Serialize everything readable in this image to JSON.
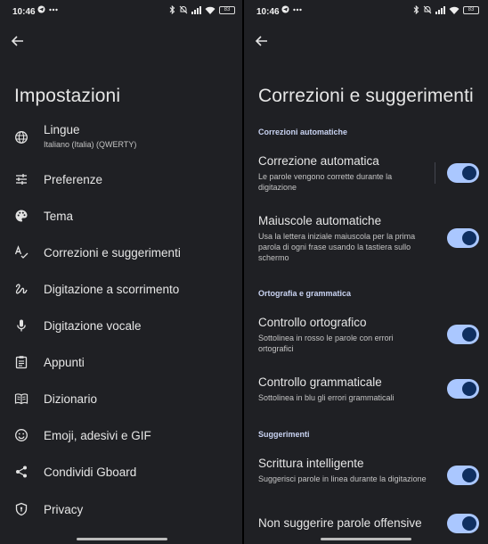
{
  "status": {
    "time": "10:46",
    "battery": "83"
  },
  "left": {
    "title": "Impostazioni",
    "items": [
      {
        "label": "Lingue",
        "sub": "Italiano (Italia) (QWERTY)",
        "icon": "globe-icon"
      },
      {
        "label": "Preferenze",
        "icon": "sliders-icon"
      },
      {
        "label": "Tema",
        "icon": "palette-icon"
      },
      {
        "label": "Correzioni e suggerimenti",
        "icon": "spellcheck-icon"
      },
      {
        "label": "Digitazione a scorrimento",
        "icon": "gesture-icon"
      },
      {
        "label": "Digitazione vocale",
        "icon": "microphone-icon"
      },
      {
        "label": "Appunti",
        "icon": "clipboard-icon"
      },
      {
        "label": "Dizionario",
        "icon": "book-icon"
      },
      {
        "label": "Emoji, adesivi e GIF",
        "icon": "emoji-icon"
      },
      {
        "label": "Condividi Gboard",
        "icon": "share-icon"
      },
      {
        "label": "Privacy",
        "icon": "shield-icon"
      }
    ]
  },
  "right": {
    "title": "Correzioni e suggerimenti",
    "sections": [
      {
        "header": "Correzioni automatiche"
      },
      {
        "header": "Ortografia e grammatica"
      },
      {
        "header": "Suggerimenti"
      }
    ],
    "settings": [
      {
        "title": "Correzione automatica",
        "desc": "Le parole vengono corrette durante la digitazione",
        "on": true
      },
      {
        "title": "Maiuscole automatiche",
        "desc": "Usa la lettera iniziale maiuscola per la prima parola di ogni frase usando la tastiera sullo schermo",
        "on": true
      },
      {
        "title": "Controllo ortografico",
        "desc": "Sottolinea in rosso le parole con errori ortografici",
        "on": true
      },
      {
        "title": "Controllo grammaticale",
        "desc": "Sottolinea in blu gli errori grammaticali",
        "on": true
      },
      {
        "title": "Scrittura intelligente",
        "desc": "Suggerisci parole in linea durante la digitazione",
        "on": true
      },
      {
        "title": "Non suggerire parole offensive",
        "desc": "",
        "on": true
      }
    ]
  },
  "colors": {
    "background": "#1f2024",
    "toggle_track": "#aac7ff",
    "toggle_knob": "#0f2f60"
  }
}
